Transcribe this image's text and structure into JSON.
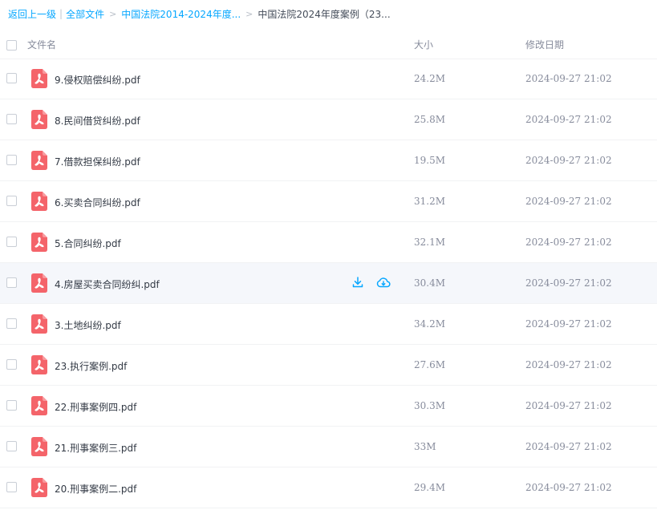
{
  "breadcrumb": {
    "back_label": "返回上一级",
    "pipe": "|",
    "all_files_label": "全部文件",
    "sep": ">",
    "folder_label": "中国法院2014-2024年度...",
    "current_label": "中国法院2024年度案例（23..."
  },
  "header": {
    "name": "文件名",
    "size": "大小",
    "date": "修改日期"
  },
  "accent_color": "#06a7ff",
  "pdf_icon_color": "#f4646a",
  "files": [
    {
      "name": "9.侵权赔偿纠纷.pdf",
      "size": "24.2M",
      "date": "2024-09-27 21:02"
    },
    {
      "name": "8.民间借贷纠纷.pdf",
      "size": "25.8M",
      "date": "2024-09-27 21:02"
    },
    {
      "name": "7.借款担保纠纷.pdf",
      "size": "19.5M",
      "date": "2024-09-27 21:02"
    },
    {
      "name": "6.买卖合同纠纷.pdf",
      "size": "31.2M",
      "date": "2024-09-27 21:02"
    },
    {
      "name": "5.合同纠纷.pdf",
      "size": "32.1M",
      "date": "2024-09-27 21:02"
    },
    {
      "name": "4.房屋买卖合同纷纠.pdf",
      "size": "30.4M",
      "date": "2024-09-27 21:02"
    },
    {
      "name": "3.土地纠纷.pdf",
      "size": "34.2M",
      "date": "2024-09-27 21:02"
    },
    {
      "name": "23.执行案例.pdf",
      "size": "27.6M",
      "date": "2024-09-27 21:02"
    },
    {
      "name": "22.刑事案例四.pdf",
      "size": "30.3M",
      "date": "2024-09-27 21:02"
    },
    {
      "name": "21.刑事案例三.pdf",
      "size": "33M",
      "date": "2024-09-27 21:02"
    },
    {
      "name": "20.刑事案例二.pdf",
      "size": "29.4M",
      "date": "2024-09-27 21:02"
    }
  ]
}
